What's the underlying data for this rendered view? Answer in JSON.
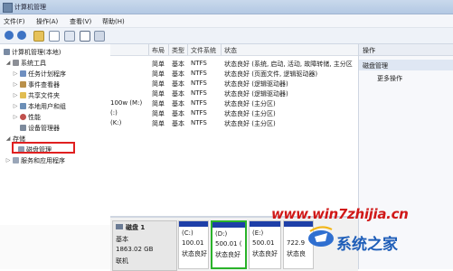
{
  "window": {
    "title": "计算机管理"
  },
  "menu": [
    "文件(F)",
    "操作(A)",
    "查看(V)",
    "帮助(H)"
  ],
  "toolbar": {
    "icons": [
      "back-icon",
      "forward-icon",
      "up-folder-icon",
      "show-hide-tree-icon",
      "properties-icon",
      "help-icon",
      "console-icon"
    ]
  },
  "tree": {
    "root": "计算机管理(本地)",
    "system_tools": "系统工具",
    "items": [
      "任务计划程序",
      "事件查看器",
      "共享文件夹",
      "本地用户和组",
      "性能",
      "设备管理器"
    ],
    "storage": "存储",
    "disk_management": "磁盘管理",
    "services": "服务和应用程序"
  },
  "grid": {
    "headers": [
      "布局",
      "类型",
      "文件系统",
      "状态"
    ],
    "rows": [
      {
        "name": "",
        "layout": "简单",
        "type": "基本",
        "fs": "NTFS",
        "status": "状态良好 (系统, 启动, 活动, 故障转储, 主分区"
      },
      {
        "name": "",
        "layout": "简单",
        "type": "基本",
        "fs": "NTFS",
        "status": "状态良好 (页面文件, 逻辑驱动器)"
      },
      {
        "name": "",
        "layout": "简单",
        "type": "基本",
        "fs": "NTFS",
        "status": "状态良好 (逻辑驱动器)"
      },
      {
        "name": "",
        "layout": "简单",
        "type": "基本",
        "fs": "NTFS",
        "status": "状态良好 (逻辑驱动器)"
      },
      {
        "name": "100w (M:)",
        "layout": "简单",
        "type": "基本",
        "fs": "NTFS",
        "status": "状态良好 (主分区)"
      },
      {
        "name": "(:)",
        "layout": "简单",
        "type": "基本",
        "fs": "NTFS",
        "status": "状态良好 (主分区)"
      },
      {
        "name": "(K:)",
        "layout": "简单",
        "type": "基本",
        "fs": "NTFS",
        "status": "状态良好 (主分区)"
      }
    ]
  },
  "actions": {
    "title": "操作",
    "section": "磁盘管理",
    "more": "更多操作"
  },
  "disk": {
    "name": "磁盘 1",
    "type": "基本",
    "size": "1863.02 GB",
    "state": "联机",
    "volumes": [
      {
        "letter": "(C:)",
        "size": "100.01",
        "status": "状态良好"
      },
      {
        "letter": "(D:)",
        "size": "500.01 (",
        "status": "状态良好"
      },
      {
        "letter": "(E:)",
        "size": "500.01",
        "status": "状态良好"
      },
      {
        "letter": "",
        "size": "722.9",
        "status": "状态良"
      }
    ]
  },
  "watermark": {
    "url": "www.win7zhijia.cn",
    "brand": "系统之家"
  },
  "colors": {
    "volume_bar": "#1e3fa8",
    "highlight": "#e02020",
    "watermark_red": "#d01818",
    "watermark_blue": "#1d5db8"
  }
}
